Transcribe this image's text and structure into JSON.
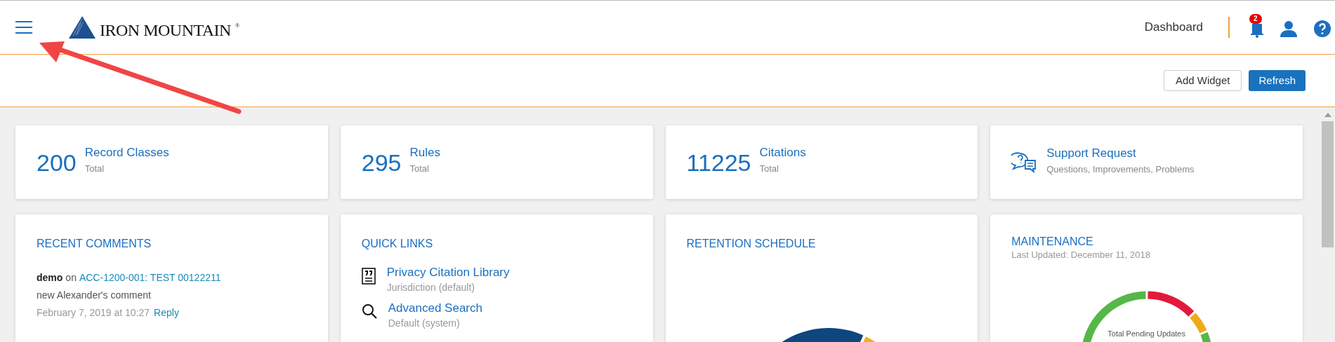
{
  "header": {
    "logo": {
      "name": "IRON MOUNTAIN",
      "mark": "®"
    },
    "nav_label": "Dashboard",
    "notifications": {
      "count": "2"
    }
  },
  "toolbar": {
    "buttons": [
      {
        "label": "Add Widget",
        "kind": "secondary"
      },
      {
        "label": "Refresh",
        "kind": "primary"
      }
    ]
  },
  "stats": [
    {
      "value": "200",
      "label": "Record Classes",
      "sub": "Total"
    },
    {
      "value": "295",
      "label": "Rules",
      "sub": "Total"
    },
    {
      "value": "11225",
      "label": "Citations",
      "sub": "Total"
    }
  ],
  "support": {
    "title": "Support Request",
    "subtitle": "Questions, Improvements, Problems"
  },
  "recent_comments": {
    "title": "RECENT COMMENTS",
    "comments": [
      {
        "author": "demo",
        "connector": "on",
        "target": "ACC-1200-001: TEST 00122211",
        "text": "new Alexander's comment",
        "date": "February 7, 2019 at 10:27",
        "reply": "Reply"
      }
    ]
  },
  "quick_links": {
    "title": "QUICK LINKS",
    "links": [
      {
        "kind": "citation",
        "title": "Privacy Citation Library",
        "sub": "Jurisdiction (default)"
      },
      {
        "kind": "search",
        "title": "Advanced Search",
        "sub": "Default (system)"
      }
    ]
  },
  "retention_schedule": {
    "title": "RETENTION SCHEDULE"
  },
  "maintenance": {
    "title": "MAINTENANCE",
    "updated": "Last Updated: December 11, 2018",
    "center_label": "Total Pending Updates"
  }
}
